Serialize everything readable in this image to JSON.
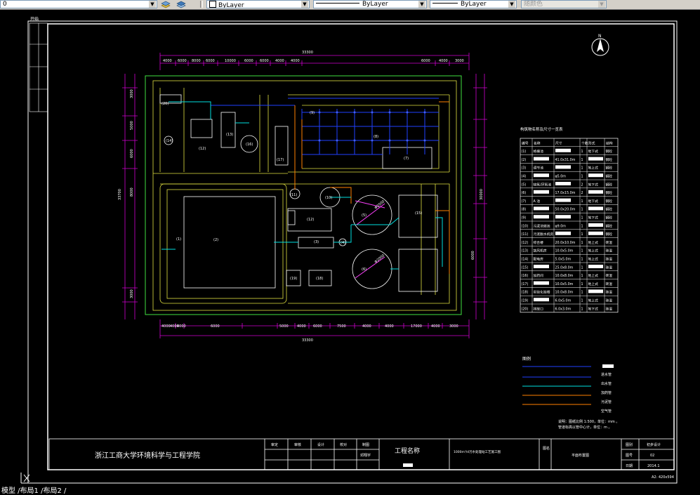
{
  "toolbar": {
    "layer_value": "0",
    "color_value": "ByLayer",
    "linetype_value": "ByLayer",
    "lineweight_value": "ByLayer",
    "plotstyle_value": "随颜色"
  },
  "drawing": {
    "corner_label": "开始",
    "school": "浙江工商大学环境科学与工程学院",
    "project_name_label": "工程名称",
    "project_desc": "1000m³/d污水处理站工艺施工图",
    "drawing_title": "平面布置图",
    "title_headers": [
      "审定",
      "审核",
      "设计",
      "校对",
      "制图"
    ],
    "drafter": "邓翔宇",
    "stage_label": "图别",
    "stage_value": "初步设计",
    "number_label": "图号",
    "number_value": "02",
    "date_label": "日期",
    "date_value": "2014.1",
    "tuming_label": "图名",
    "sheet_size": "A2: 420x594",
    "legend_title": "图例",
    "legend_items": [
      "进水管",
      "出水管",
      "加药管",
      "污泥管",
      "空气管"
    ],
    "notes": [
      "说明：图纸比例 1:500，单位：mm 。",
      "管道标高以管中心计，单位：m 。"
    ],
    "table_title": "构筑物名称及尺寸一览表",
    "table_headers": [
      "编号",
      "名称",
      "尺寸",
      "个数",
      "形式",
      "结构"
    ],
    "table_rows": [
      [
        "(1)",
        "格栅池",
        "",
        "1",
        "地下式",
        "钢砼"
      ],
      [
        "(2)",
        "",
        "41.0x31.0m",
        "1",
        "",
        "钢砼"
      ],
      [
        "(3)",
        "调节池",
        "",
        "1",
        "地上式",
        "钢砼"
      ],
      [
        "(4)",
        "",
        "φ5.0m",
        "1",
        "",
        "钢砼"
      ],
      [
        "(5)",
        "缺氧/厌氧池",
        "",
        "2",
        "地下式",
        "钢砼"
      ],
      [
        "(6)",
        "",
        "17.0x15.0m",
        "2",
        "",
        "钢砼"
      ],
      [
        "(7)",
        "A 池",
        "",
        "1",
        "地下式",
        "钢砼"
      ],
      [
        "(8)",
        "",
        "50.0x20.0m",
        "1",
        "",
        "钢砼"
      ],
      [
        "(9)",
        "",
        "",
        "1",
        "地下式",
        "钢砼"
      ],
      [
        "(10)",
        "污泥浓缩池",
        "φ9.0m",
        "1",
        "",
        "钢砼"
      ],
      [
        "(11)",
        "污泥脱水机房",
        "",
        "1",
        "",
        "钢砼"
      ],
      [
        "(12)",
        "综合楼",
        "20.0x10.0m",
        "1",
        "地上式",
        "砖混"
      ],
      [
        "(13)",
        "鼓风机房",
        "10.0x5.0m",
        "1",
        "地上式",
        "砖混"
      ],
      [
        "(14)",
        "配电房",
        "5.0x5.0m",
        "1",
        "地上式",
        "砖混"
      ],
      [
        "(15)",
        "",
        "25.0x8.0m",
        "1",
        "",
        "砖混"
      ],
      [
        "(16)",
        "加药间",
        "10.0x8.0m",
        "1",
        "地上式",
        "砖混"
      ],
      [
        "(17)",
        "",
        "10.0x5.0m",
        "1",
        "地上式",
        "砖混"
      ],
      [
        "(18)",
        "实验化验楼",
        "10.0x8.0m",
        "1",
        "",
        "砖混"
      ],
      [
        "(19)",
        "",
        "6.0x5.0m",
        "1",
        "地上式",
        "砖混"
      ],
      [
        "(20)",
        "排放口",
        "6.0x3.0m",
        "1",
        "地下式",
        "砖混"
      ]
    ],
    "dims_top": [
      "33300",
      "4000",
      "6000",
      "8000",
      "6000",
      "10000",
      "6000",
      "6000",
      "4000",
      "4000",
      "6000",
      "4000",
      "3000"
    ],
    "dims_bottom": [
      "33300",
      "4000",
      "4000",
      "4000",
      "6000",
      "5000",
      "4000",
      "6000",
      "7500",
      "4000",
      "4000",
      "17000",
      "4000",
      "3000"
    ],
    "dims_side": [
      "33700",
      "3000",
      "5000",
      "6000",
      "8000",
      "30000",
      "6000",
      "3000"
    ],
    "unit_labels": [
      "(1)",
      "(2)",
      "(3)",
      "(4)",
      "(5)",
      "(6)",
      "(7)",
      "(8)",
      "(9)",
      "(10)",
      "(11)",
      "(12)",
      "(13)",
      "(14)",
      "(15)",
      "(16)",
      "(17)",
      "(18)",
      "(19)",
      "(20)"
    ],
    "circle_dims": [
      "Φ2500",
      "Φ2000"
    ]
  },
  "status": {
    "tabs": "模型 /布局1 /布局2 /"
  }
}
